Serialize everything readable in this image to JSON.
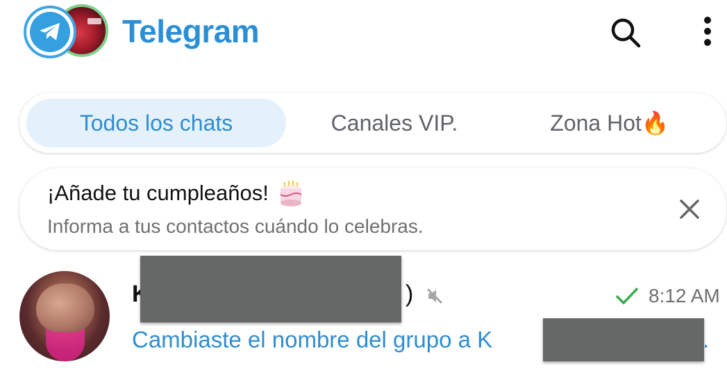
{
  "header": {
    "title": "Telegram",
    "logo_icon": "telegram-logo-icon",
    "story_icon": "story-avatar",
    "search_icon": "search-icon",
    "menu_icon": "more-vertical-icon",
    "accent_color": "#2b8fd6"
  },
  "tabs": [
    {
      "label": "Todos los chats",
      "active": true
    },
    {
      "label": "Canales VIP.",
      "active": false
    },
    {
      "label": "Zona Hot🔥",
      "active": false
    }
  ],
  "birthday_card": {
    "title": "¡Añade tu cumpleaños!",
    "icon": "birthday-cake-icon",
    "subtitle": "Informa a tus contactos cuándo lo celebras.",
    "close_icon": "close-icon"
  },
  "chats": [
    {
      "name_visible_start": "K",
      "name_visible_end": ")",
      "muted": true,
      "status_icon": "check-icon",
      "time": "8:12 AM",
      "preview": "Cambiaste el nombre del grupo a K",
      "preview_end": "."
    }
  ]
}
